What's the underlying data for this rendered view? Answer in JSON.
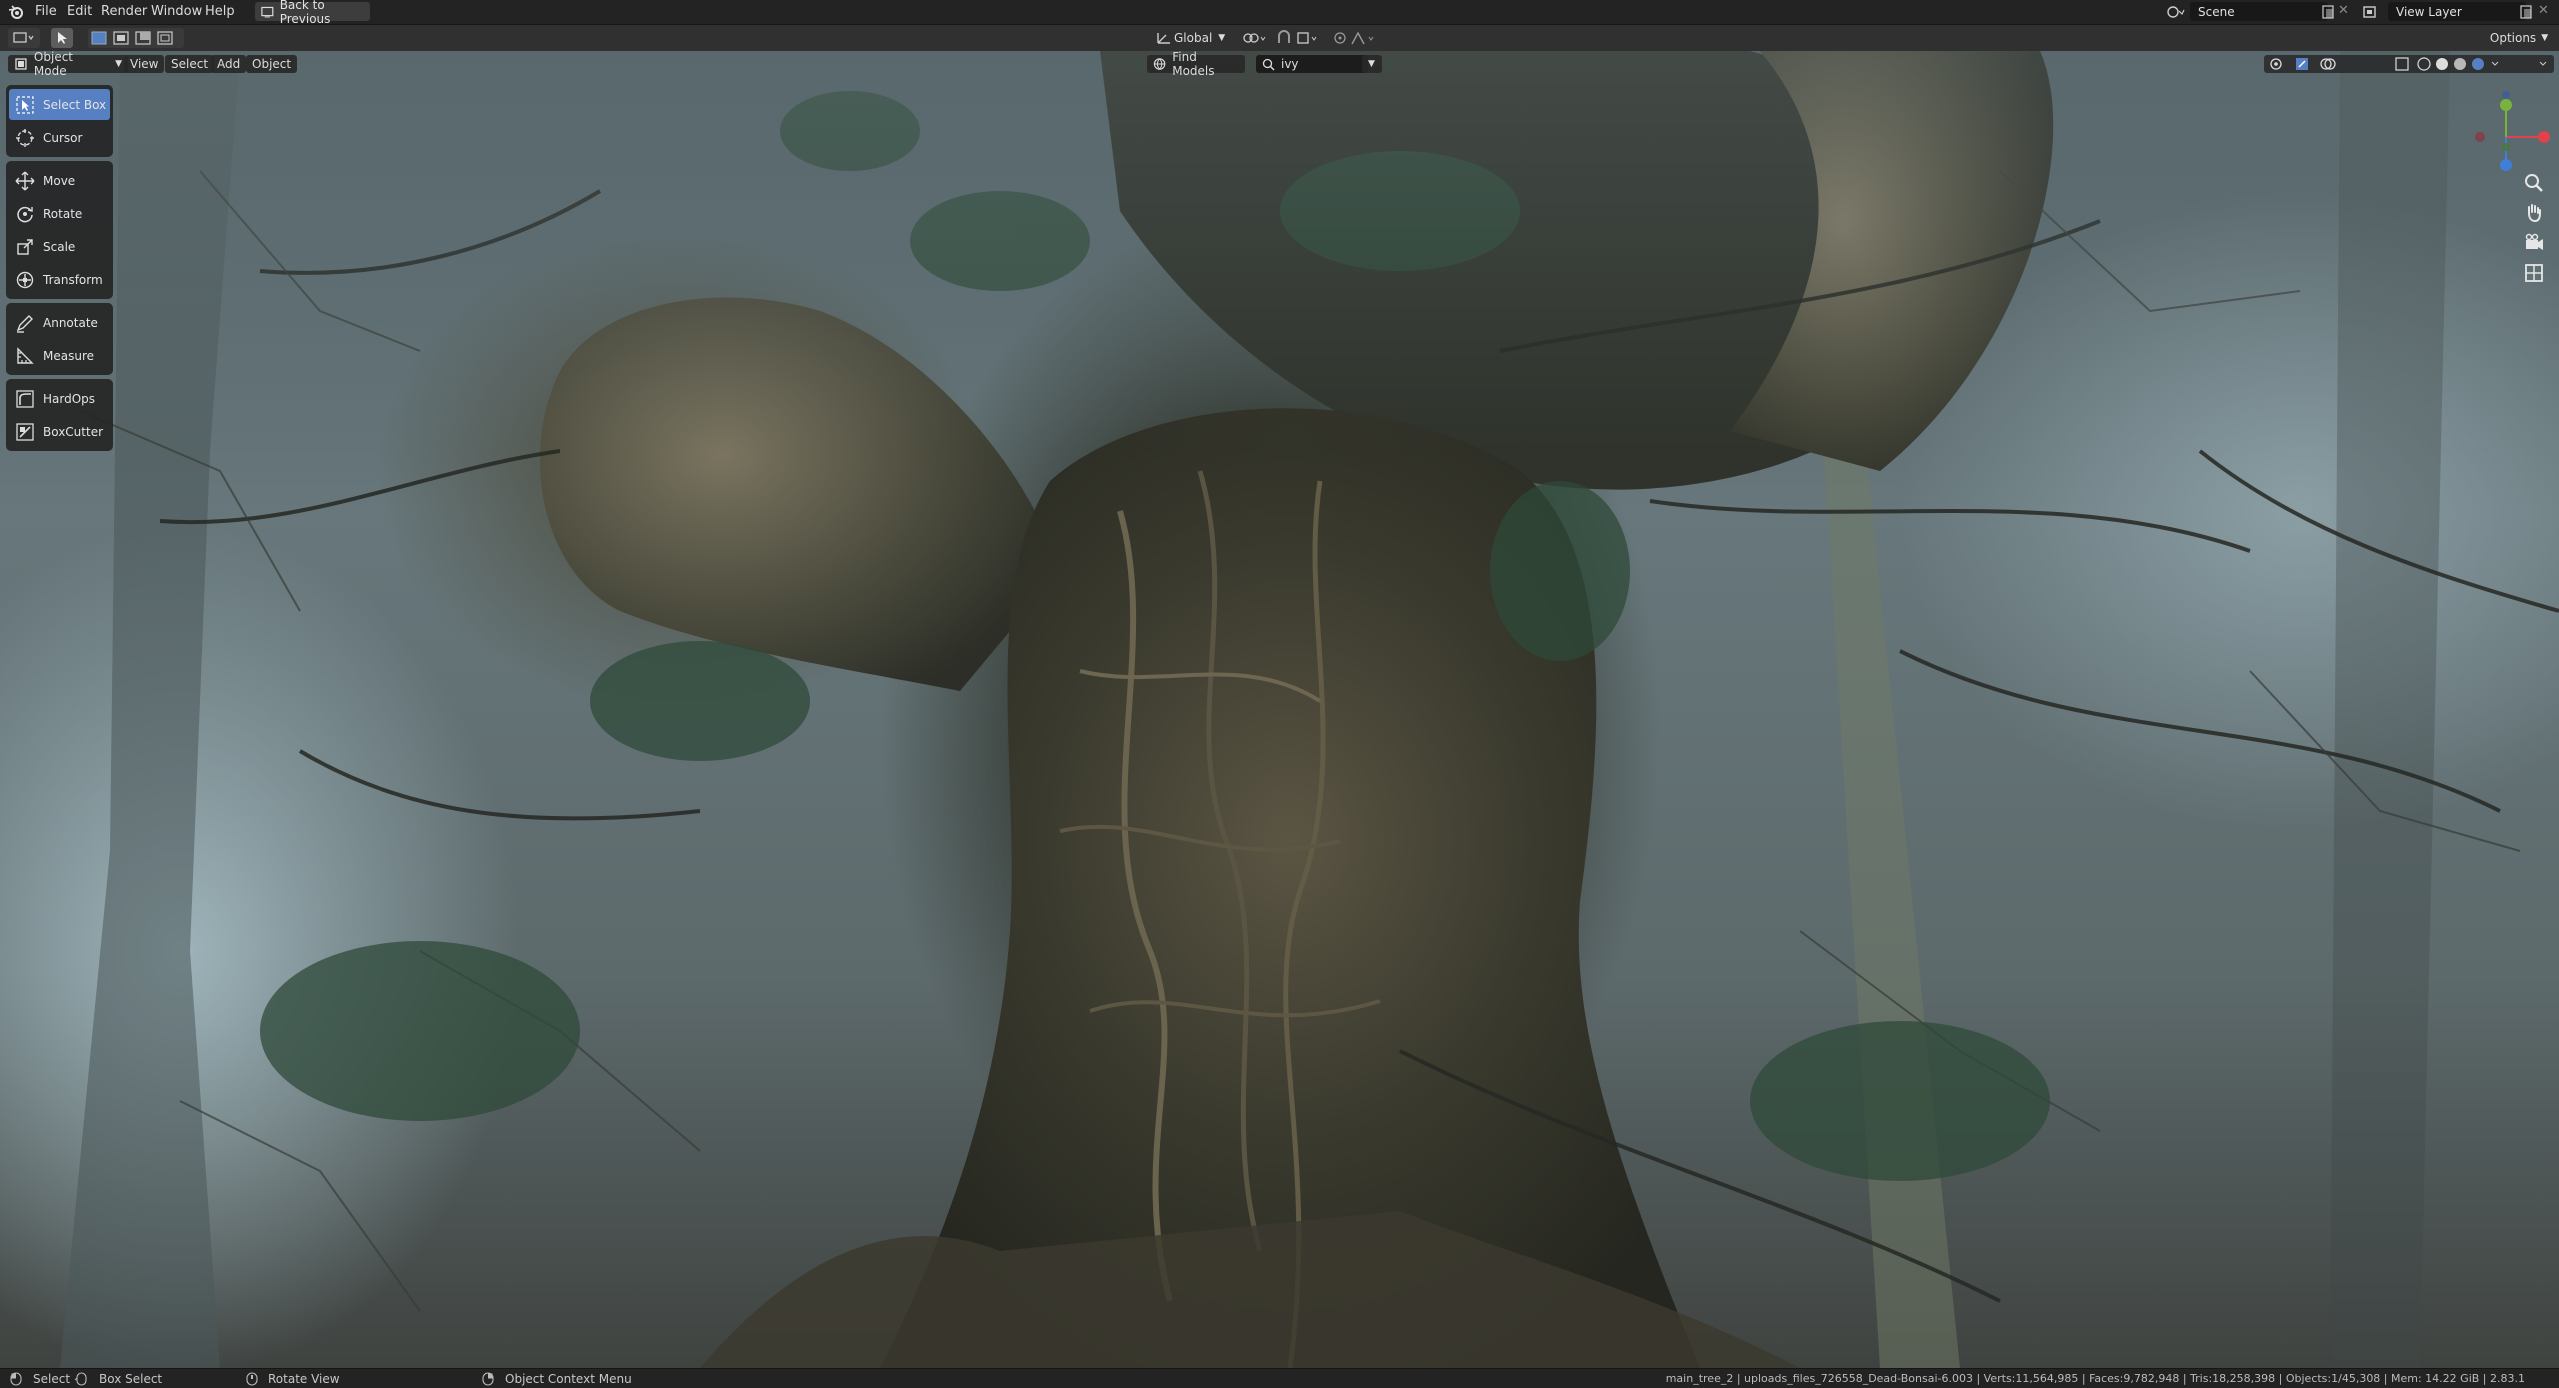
{
  "menubar": {
    "items": [
      "File",
      "Edit",
      "Render",
      "Window",
      "Help"
    ],
    "back_button": "Back to Previous",
    "scene_label": "Scene",
    "view_layer_label": "View Layer"
  },
  "header": {
    "mode": "Object Mode",
    "menus": [
      "View",
      "Select",
      "Add",
      "Object"
    ],
    "transform_orientation": "Global",
    "options": "Options",
    "find_models": "Find Models",
    "search_value": "ivy"
  },
  "toolbar": {
    "groups": [
      [
        {
          "label": "Select Box",
          "icon": "select-box-icon",
          "active": true
        },
        {
          "label": "Cursor",
          "icon": "cursor-icon"
        }
      ],
      [
        {
          "label": "Move",
          "icon": "move-icon"
        },
        {
          "label": "Rotate",
          "icon": "rotate-icon"
        },
        {
          "label": "Scale",
          "icon": "scale-icon"
        },
        {
          "label": "Transform",
          "icon": "transform-icon"
        }
      ],
      [
        {
          "label": "Annotate",
          "icon": "annotate-icon"
        },
        {
          "label": "Measure",
          "icon": "measure-icon"
        }
      ],
      [
        {
          "label": "HardOps",
          "icon": "hardops-icon"
        },
        {
          "label": "BoxCutter",
          "icon": "boxcutter-icon"
        }
      ]
    ]
  },
  "statusbar": {
    "select": "Select",
    "box_select": "Box Select",
    "rotate_view": "Rotate View",
    "context_menu": "Object Context Menu",
    "stats": "main_tree_2 | uploads_files_726558_Dead-Bonsai-6.003 | Verts:11,564,985 | Faces:9,782,948 | Tris:18,258,398 | Objects:1/45,308 | Mem: 14.22 GiB | 2.83.1"
  },
  "colors": {
    "accent": "#5680c2",
    "axis_x": "#e0414a",
    "axis_y": "#7ab33c",
    "axis_z": "#3f7fd8"
  }
}
